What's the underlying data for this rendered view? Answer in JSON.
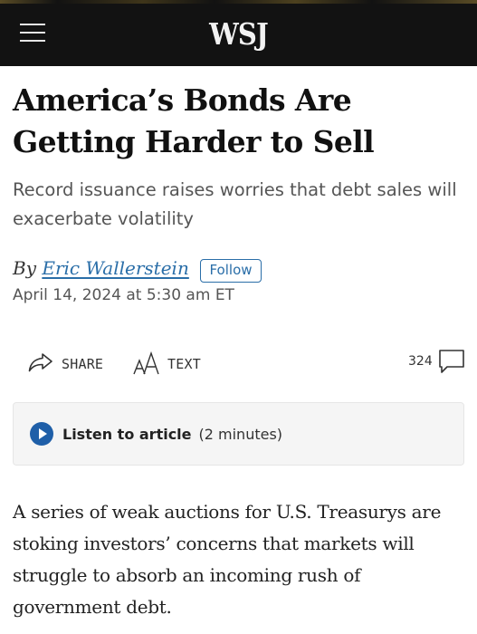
{
  "header": {
    "logo": "WSJ",
    "menu_icon": "hamburger-menu-icon"
  },
  "article": {
    "headline": "America’s Bonds Are Getting Harder to Sell",
    "dek": "Record issuance raises worries that debt sales will exacerbate volatility",
    "byline_prefix": "By ",
    "author": "Eric Wallerstein",
    "follow_label": "Follow",
    "date": "April 14, 2024 at 5:30 am ET",
    "body": "A series of weak auctions for U.S. Treasurys are stoking investors’ concerns that markets will struggle to absorb an incoming rush of government debt."
  },
  "toolbar": {
    "share_label": "SHARE",
    "share_icon": "share-arrow-icon",
    "text_label": "TEXT",
    "text_icon": "text-size-icon",
    "comment_count": "324",
    "comment_icon": "comment-bubble-icon"
  },
  "listen": {
    "label": "Listen to article",
    "duration": "(2 minutes)",
    "icon": "play-icon"
  },
  "colors": {
    "header_bg": "#121212",
    "link": "#2a6ea8",
    "play_button": "#1f5fa8"
  }
}
